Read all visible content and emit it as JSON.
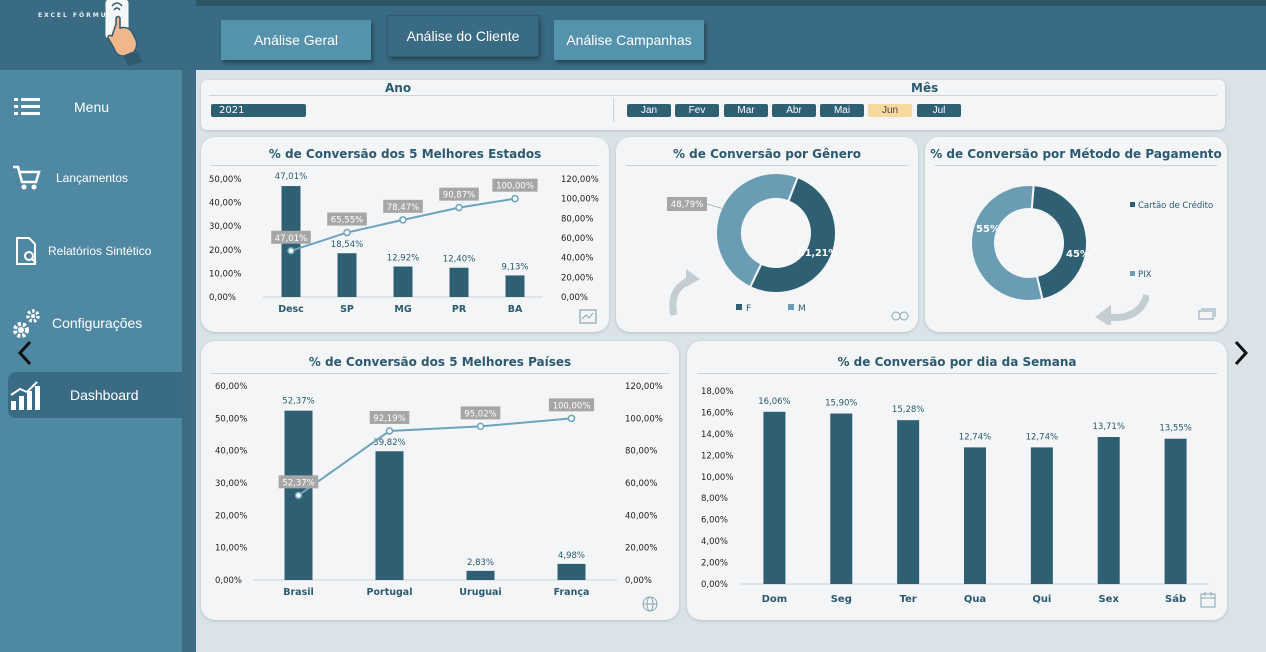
{
  "brand": {
    "logo_text": "EXCEL FÓRMULA"
  },
  "sidebar": {
    "items": [
      {
        "label": "Menu",
        "icon": "menu-icon"
      },
      {
        "label": "Lançamentos",
        "icon": "cart-icon"
      },
      {
        "label": "Relatórios Sintético",
        "icon": "report-icon"
      },
      {
        "label": "Configurações",
        "icon": "gear-icon"
      },
      {
        "label": "Dashboard",
        "icon": "chart-icon",
        "active": true
      }
    ]
  },
  "tabs": [
    {
      "label": "Análise Geral"
    },
    {
      "label": "Análise do Cliente",
      "active": true
    },
    {
      "label": "Análise Campanhas"
    }
  ],
  "filters": {
    "year_label": "Ano",
    "year_value": "2021",
    "month_label": "Mês",
    "months": [
      "Jan",
      "Fev",
      "Mar",
      "Abr",
      "Mai",
      "Jun",
      "Jul"
    ],
    "selected_month": "Jun"
  },
  "colors": {
    "bar": "#2f5f73",
    "line": "#6ea3bd",
    "donut_light": "#6a9cb4",
    "donut_dark": "#2f5f73"
  },
  "chart_data": [
    {
      "id": "estados",
      "type": "bar+line",
      "title": "% de Conversão dos 5 Melhores Estados",
      "categories": [
        "Desc",
        "SP",
        "MG",
        "PR",
        "BA"
      ],
      "series": [
        {
          "values": [
            47.01,
            18.54,
            12.92,
            12.4,
            9.13
          ],
          "labels": [
            "47,01%",
            "18,54%",
            "12,92%",
            "12,40%",
            "9,13%"
          ]
        },
        {
          "values": [
            47.01,
            65.55,
            78.47,
            90.87,
            100.0
          ],
          "labels": [
            "47,01%",
            "65,55%",
            "78,47%",
            "90,87%",
            "100,00%"
          ]
        }
      ],
      "y_left_ticks": [
        "50,00%",
        "40,00%",
        "30,00%",
        "20,00%",
        "10,00%",
        "0,00%"
      ],
      "y_right_ticks": [
        "120,00%",
        "100,00%",
        "80,00%",
        "60,00%",
        "40,00%",
        "20,00%",
        "0,00%"
      ],
      "ylim_left": [
        0,
        50
      ],
      "ylim_right": [
        0,
        120
      ]
    },
    {
      "id": "genero",
      "type": "pie",
      "title": "% de Conversão por Gênero",
      "categories": [
        "F",
        "M"
      ],
      "values": [
        51.21,
        48.79
      ],
      "labels": [
        "51,21%",
        "48,79%"
      ]
    },
    {
      "id": "pagamento",
      "type": "pie",
      "title": "% de Conversão por Método de Pagamento",
      "categories": [
        "Cartão de Crédito",
        "PIX"
      ],
      "values": [
        45,
        55
      ],
      "labels": [
        "45%",
        "55%"
      ]
    },
    {
      "id": "paises",
      "type": "bar+line",
      "title": "% de Conversão dos 5 Melhores Países",
      "categories": [
        "Brasil",
        "Portugal",
        "Uruguai",
        "França"
      ],
      "series": [
        {
          "values": [
            52.37,
            39.82,
            2.83,
            4.98
          ],
          "labels": [
            "52,37%",
            "39,82%",
            "2,83%",
            "4,98%"
          ]
        },
        {
          "values": [
            52.37,
            92.19,
            95.02,
            100.0
          ],
          "labels": [
            "52,37%",
            "92,19%",
            "95,02%",
            "100,00%"
          ]
        }
      ],
      "y_left_ticks": [
        "60,00%",
        "50,00%",
        "40,00%",
        "30,00%",
        "20,00%",
        "10,00%",
        "0,00%"
      ],
      "y_right_ticks": [
        "120,00%",
        "100,00%",
        "80,00%",
        "60,00%",
        "40,00%",
        "20,00%",
        "0,00%"
      ],
      "ylim_left": [
        0,
        60
      ],
      "ylim_right": [
        0,
        120
      ]
    },
    {
      "id": "semana",
      "type": "bar",
      "title": "% de Conversão por dia da Semana",
      "categories": [
        "Dom",
        "Seg",
        "Ter",
        "Qua",
        "Qui",
        "Sex",
        "Sáb"
      ],
      "values": [
        16.06,
        15.9,
        15.28,
        12.74,
        12.74,
        13.71,
        13.55
      ],
      "labels": [
        "16,06%",
        "15,90%",
        "15,28%",
        "12,74%",
        "12,74%",
        "13,71%",
        "13,55%"
      ],
      "y_ticks": [
        "18,00%",
        "16,00%",
        "14,00%",
        "12,00%",
        "10,00%",
        "8,00%",
        "6,00%",
        "4,00%",
        "2,00%",
        "0,00%"
      ],
      "ylim": [
        0,
        18
      ]
    }
  ]
}
